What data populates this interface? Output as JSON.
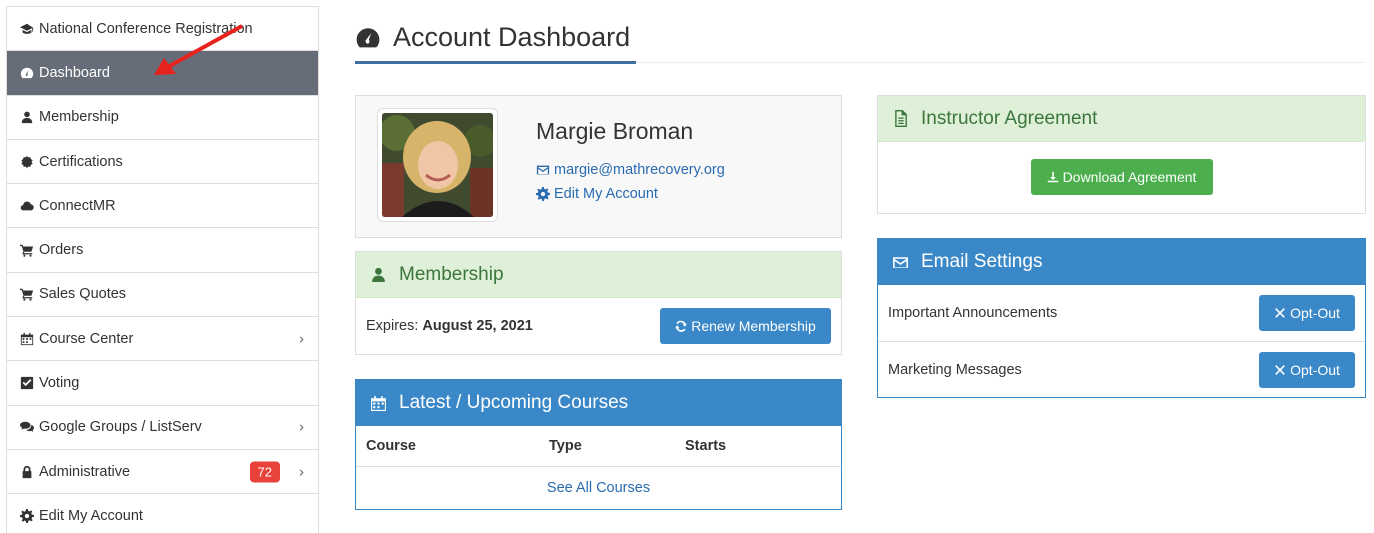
{
  "sidebar": {
    "items": [
      {
        "label": "National Conference Registration",
        "icon": "graduation-cap-icon"
      },
      {
        "label": "Dashboard",
        "icon": "tachometer-icon"
      },
      {
        "label": "Membership",
        "icon": "user-icon"
      },
      {
        "label": "Certifications",
        "icon": "certificate-icon"
      },
      {
        "label": "ConnectMR",
        "icon": "cloud-icon"
      },
      {
        "label": "Orders",
        "icon": "cart-icon"
      },
      {
        "label": "Sales Quotes",
        "icon": "cart-icon"
      },
      {
        "label": "Course Center",
        "icon": "calendar-icon"
      },
      {
        "label": "Voting",
        "icon": "check-square-icon"
      },
      {
        "label": "Google Groups / ListServ",
        "icon": "comments-icon"
      },
      {
        "label": "Administrative",
        "icon": "lock-icon",
        "badge": "72"
      },
      {
        "label": "Edit My Account",
        "icon": "gear-icon"
      }
    ]
  },
  "header": {
    "title": "Account Dashboard",
    "icon": "tachometer-icon"
  },
  "profile": {
    "name": "Margie Broman",
    "email": "margie@mathrecovery.org",
    "edit_link": "Edit My Account"
  },
  "membership": {
    "title": "Membership",
    "expires_label": "Expires:",
    "expires_date": "August 25, 2021",
    "renew_button": "Renew Membership"
  },
  "courses": {
    "title": "Latest / Upcoming Courses",
    "columns": [
      "Course",
      "Type",
      "Starts"
    ],
    "see_all": "See All Courses"
  },
  "agreement": {
    "title": "Instructor Agreement",
    "download_button": "Download Agreement"
  },
  "email_settings": {
    "title": "Email Settings",
    "rows": [
      {
        "label": "Important Announcements",
        "button": "Opt-Out"
      },
      {
        "label": "Marketing Messages",
        "button": "Opt-Out"
      }
    ]
  },
  "colors": {
    "sidebar_active": "#666d78",
    "primary_blue": "#3a88c8",
    "success_green": "#4cae4c",
    "panel_green_bg": "#dff0d8",
    "badge_red": "#e8423a",
    "annotation_arrow": "#e8231d"
  }
}
